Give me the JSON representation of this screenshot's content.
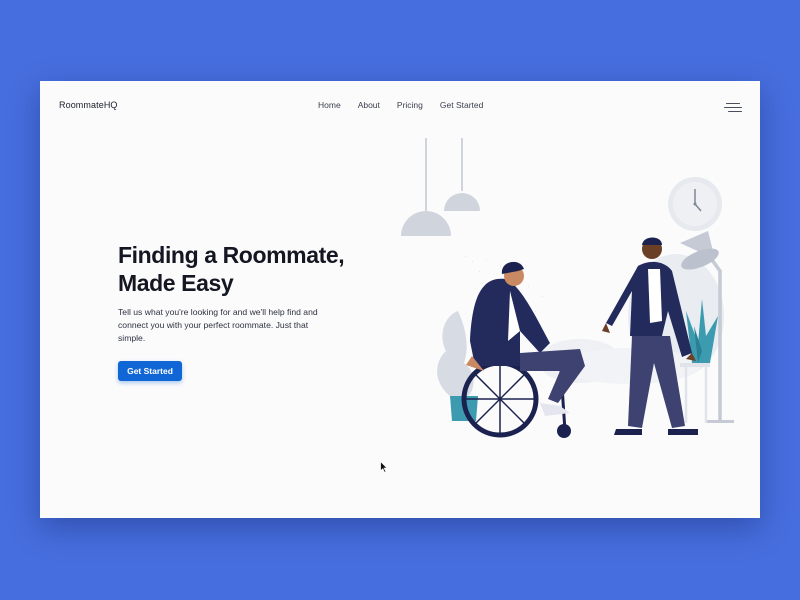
{
  "nav": {
    "brand": "RoommateHQ",
    "links": [
      {
        "label": "Home"
      },
      {
        "label": "About"
      },
      {
        "label": "Pricing"
      },
      {
        "label": "Get Started"
      }
    ],
    "menu_icon": "hamburger-menu-icon"
  },
  "hero": {
    "title_line1": "Finding a Roommate,",
    "title_line2": "Made Easy",
    "description": "Tell us what you're looking for and we'll help find and connect you with your perfect roommate. Just that simple.",
    "cta_label": "Get Started"
  },
  "illustration": {
    "icons": [
      "pendant-lamp-icon",
      "wall-clock-icon",
      "floor-lamp-icon",
      "potted-plant-icon",
      "wheelchair-person-icon",
      "walking-person-icon"
    ]
  },
  "colors": {
    "page_background": "#476ede",
    "card_background": "#fbfbfc",
    "accent": "#1166d6",
    "figure_navy": "#232a5c",
    "illustration_gray": "#d3d8e1",
    "plant_teal": "#3d9bb0"
  }
}
